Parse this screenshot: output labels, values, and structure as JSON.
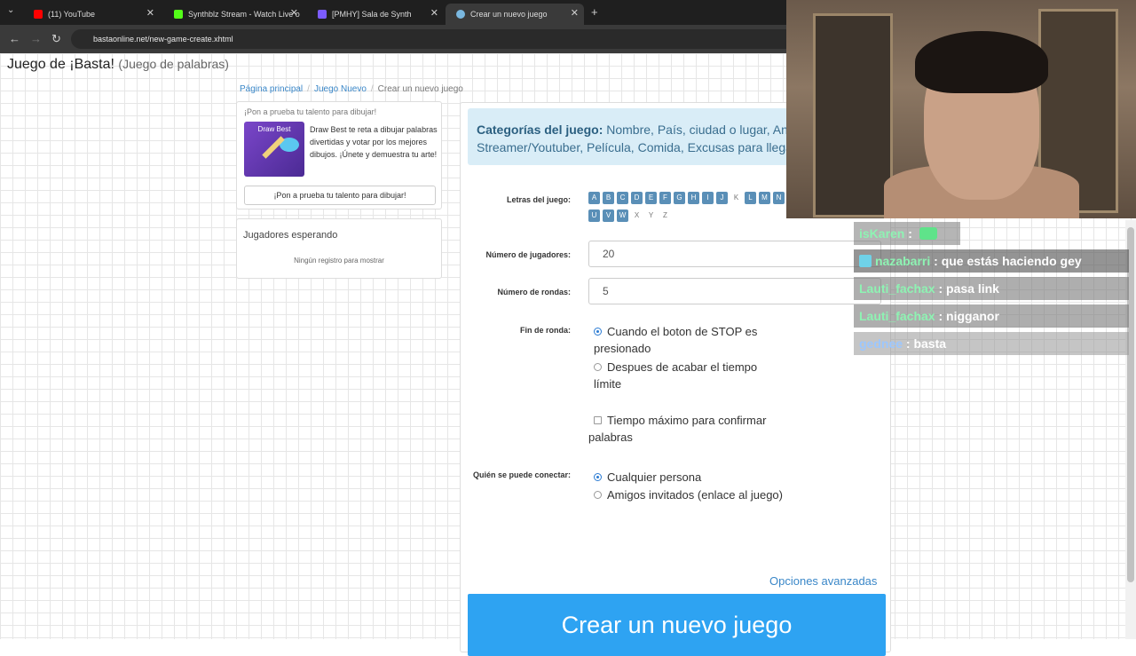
{
  "browser": {
    "tabs": [
      {
        "title": "(11) YouTube",
        "color": "#ff0000"
      },
      {
        "title": "Synthblz Stream - Watch Live o",
        "color": "#53fc18"
      },
      {
        "title": "[PMHY] Sala de Synth",
        "color": "#7c5cff"
      },
      {
        "title": "Crear un nuevo juego",
        "color": "#7ab8e0"
      }
    ],
    "url": "bastaonline.net/new-game-create.xhtml"
  },
  "page": {
    "title": "Juego de ¡Basta!",
    "subtitle": "(Juego de palabras)",
    "breadcrumb": [
      "Página principal",
      "Juego Nuevo",
      "Crear un nuevo juego"
    ],
    "promo": {
      "heading": "¡Pon a prueba tu talento para dibujar!",
      "image_title": "Draw Best",
      "description": "Draw Best te reta a dibujar palabras divertidas y votar por los mejores dibujos. ¡Únete y demuestra tu arte!",
      "button": "¡Pon a prueba tu talento para dibujar!"
    },
    "waiting": {
      "heading": "Jugadores esperando",
      "empty": "Ningún registro para mostrar"
    },
    "form": {
      "categories_label": "Categorías del juego:",
      "categories_text": "Nombre, País, ciudad o lugar, Animal, Streamer/Youtuber, Película, Comida, Excusas para llegar tarde",
      "letters_label": "Letras del juego:",
      "letters": [
        {
          "l": "A",
          "on": true
        },
        {
          "l": "B",
          "on": true
        },
        {
          "l": "C",
          "on": true
        },
        {
          "l": "D",
          "on": true
        },
        {
          "l": "E",
          "on": true
        },
        {
          "l": "F",
          "on": true
        },
        {
          "l": "G",
          "on": true
        },
        {
          "l": "H",
          "on": true
        },
        {
          "l": "I",
          "on": true
        },
        {
          "l": "J",
          "on": true
        },
        {
          "l": "K",
          "on": false
        },
        {
          "l": "L",
          "on": true
        },
        {
          "l": "M",
          "on": true
        },
        {
          "l": "N",
          "on": true
        },
        {
          "l": "U",
          "on": true
        },
        {
          "l": "V",
          "on": true
        },
        {
          "l": "W",
          "on": true
        },
        {
          "l": "X",
          "on": false
        },
        {
          "l": "Y",
          "on": false
        },
        {
          "l": "Z",
          "on": false
        }
      ],
      "players_label": "Número de jugadores:",
      "players_value": "20",
      "rounds_label": "Número de rondas:",
      "rounds_value": "5",
      "end_label": "Fin de ronda:",
      "end_opt1": "Cuando el boton de STOP es presionado",
      "end_opt2": "Despues de acabar el tiempo límite",
      "max_time": "Tiempo máximo para confirmar palabras",
      "connect_label": "Quién se puede conectar:",
      "connect_opt1": "Cualquier persona",
      "connect_opt2": "Amigos invitados (enlace al juego)",
      "advanced": "Opciones avanzadas",
      "create": "Crear un nuevo juego"
    }
  },
  "chat": [
    {
      "user": "isKaren",
      "text": ""
    },
    {
      "user": "nazabarri",
      "text": "que estás haciendo gey"
    },
    {
      "user": "Lauti_fachax",
      "text": "pasa link"
    },
    {
      "user": "Lauti_fachax",
      "text": "nigganor"
    },
    {
      "user": "gednee",
      "text": "basta"
    }
  ]
}
